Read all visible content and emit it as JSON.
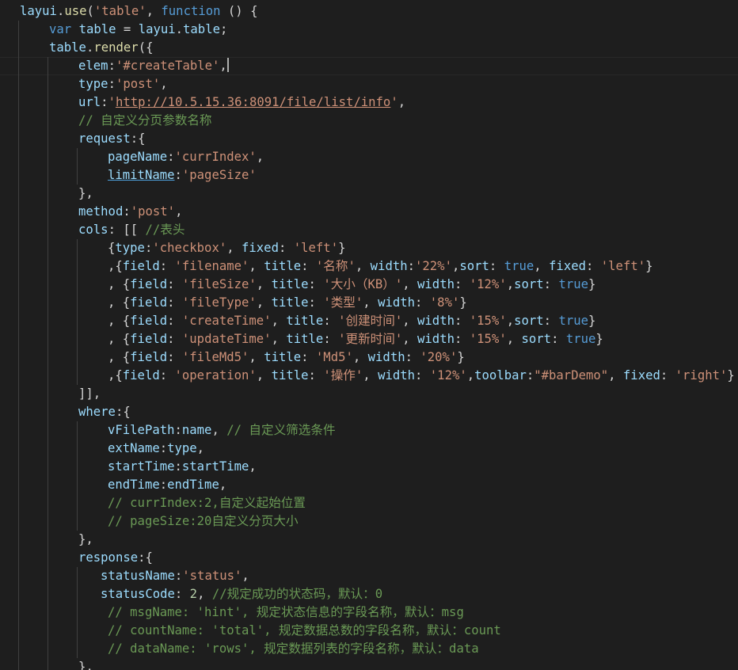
{
  "editor": {
    "background": "#1e1e1e",
    "token_colors": {
      "plain": "#d4d4d4",
      "var": "#9cdcfe",
      "str": "#ce9178",
      "kw": "#569cd6",
      "com": "#6a9955",
      "num": "#b5cea8",
      "fn": "#dcdcaa"
    },
    "cursor_line": 4,
    "lines": [
      {
        "indent": 0,
        "tokens": [
          {
            "t": "var",
            "v": "layui"
          },
          {
            "t": "plain",
            "v": "."
          },
          {
            "t": "fn",
            "v": "use"
          },
          {
            "t": "plain",
            "v": "("
          },
          {
            "t": "str",
            "v": "'table'"
          },
          {
            "t": "plain",
            "v": ", "
          },
          {
            "t": "kw",
            "v": "function"
          },
          {
            "t": "plain",
            "v": " () {"
          }
        ]
      },
      {
        "indent": 1,
        "tokens": [
          {
            "t": "kw",
            "v": "var"
          },
          {
            "t": "plain",
            "v": " "
          },
          {
            "t": "var",
            "v": "table"
          },
          {
            "t": "plain",
            "v": " = "
          },
          {
            "t": "var",
            "v": "layui"
          },
          {
            "t": "plain",
            "v": "."
          },
          {
            "t": "var",
            "v": "table"
          },
          {
            "t": "plain",
            "v": ";"
          }
        ]
      },
      {
        "indent": 1,
        "tokens": [
          {
            "t": "var",
            "v": "table"
          },
          {
            "t": "plain",
            "v": "."
          },
          {
            "t": "fn",
            "v": "render"
          },
          {
            "t": "plain",
            "v": "({"
          }
        ]
      },
      {
        "indent": 2,
        "tokens": [
          {
            "t": "var",
            "v": "elem"
          },
          {
            "t": "plain",
            "v": ":"
          },
          {
            "t": "str",
            "v": "'#createTable'"
          },
          {
            "t": "plain",
            "v": ","
          }
        ]
      },
      {
        "indent": 2,
        "tokens": [
          {
            "t": "var",
            "v": "type"
          },
          {
            "t": "plain",
            "v": ":"
          },
          {
            "t": "str",
            "v": "'post'"
          },
          {
            "t": "plain",
            "v": ","
          }
        ]
      },
      {
        "indent": 2,
        "tokens": [
          {
            "t": "var",
            "v": "url"
          },
          {
            "t": "plain",
            "v": ":"
          },
          {
            "t": "str",
            "v": "'"
          },
          {
            "t": "link",
            "v": "http://10.5.15.36:8091/file/list/info"
          },
          {
            "t": "str",
            "v": "'"
          },
          {
            "t": "plain",
            "v": ","
          }
        ]
      },
      {
        "indent": 2,
        "tokens": [
          {
            "t": "com",
            "v": "// 自定义分页参数名称"
          }
        ]
      },
      {
        "indent": 2,
        "tokens": [
          {
            "t": "var",
            "v": "request"
          },
          {
            "t": "plain",
            "v": ":{"
          }
        ]
      },
      {
        "indent": 3,
        "tokens": [
          {
            "t": "var",
            "v": "pageName"
          },
          {
            "t": "plain",
            "v": ":"
          },
          {
            "t": "str",
            "v": "'currIndex'"
          },
          {
            "t": "plain",
            "v": ","
          }
        ]
      },
      {
        "indent": 3,
        "tokens": [
          {
            "t": "warn",
            "v": "limitName"
          },
          {
            "t": "plain",
            "v": ":"
          },
          {
            "t": "str",
            "v": "'pageSize'"
          }
        ]
      },
      {
        "indent": 2,
        "tokens": [
          {
            "t": "plain",
            "v": "},"
          }
        ]
      },
      {
        "indent": 2,
        "tokens": [
          {
            "t": "var",
            "v": "method"
          },
          {
            "t": "plain",
            "v": ":"
          },
          {
            "t": "str",
            "v": "'post'"
          },
          {
            "t": "plain",
            "v": ","
          }
        ]
      },
      {
        "indent": 2,
        "tokens": [
          {
            "t": "var",
            "v": "cols"
          },
          {
            "t": "plain",
            "v": ": [[ "
          },
          {
            "t": "com",
            "v": "//表头"
          }
        ]
      },
      {
        "indent": 3,
        "tokens": [
          {
            "t": "plain",
            "v": "{"
          },
          {
            "t": "var",
            "v": "type"
          },
          {
            "t": "plain",
            "v": ":"
          },
          {
            "t": "str",
            "v": "'checkbox'"
          },
          {
            "t": "plain",
            "v": ", "
          },
          {
            "t": "var",
            "v": "fixed"
          },
          {
            "t": "plain",
            "v": ": "
          },
          {
            "t": "str",
            "v": "'left'"
          },
          {
            "t": "plain",
            "v": "}"
          }
        ]
      },
      {
        "indent": 3,
        "tokens": [
          {
            "t": "plain",
            "v": ",{"
          },
          {
            "t": "var",
            "v": "field"
          },
          {
            "t": "plain",
            "v": ": "
          },
          {
            "t": "str",
            "v": "'filename'"
          },
          {
            "t": "plain",
            "v": ", "
          },
          {
            "t": "var",
            "v": "title"
          },
          {
            "t": "plain",
            "v": ": "
          },
          {
            "t": "str",
            "v": "'名称'"
          },
          {
            "t": "plain",
            "v": ", "
          },
          {
            "t": "var",
            "v": "width"
          },
          {
            "t": "plain",
            "v": ":"
          },
          {
            "t": "str",
            "v": "'22%'"
          },
          {
            "t": "plain",
            "v": ","
          },
          {
            "t": "var",
            "v": "sort"
          },
          {
            "t": "plain",
            "v": ": "
          },
          {
            "t": "kw",
            "v": "true"
          },
          {
            "t": "plain",
            "v": ", "
          },
          {
            "t": "var",
            "v": "fixed"
          },
          {
            "t": "plain",
            "v": ": "
          },
          {
            "t": "str",
            "v": "'left'"
          },
          {
            "t": "plain",
            "v": "}"
          }
        ]
      },
      {
        "indent": 3,
        "tokens": [
          {
            "t": "plain",
            "v": ", {"
          },
          {
            "t": "var",
            "v": "field"
          },
          {
            "t": "plain",
            "v": ": "
          },
          {
            "t": "str",
            "v": "'fileSize'"
          },
          {
            "t": "plain",
            "v": ", "
          },
          {
            "t": "var",
            "v": "title"
          },
          {
            "t": "plain",
            "v": ": "
          },
          {
            "t": "str",
            "v": "'大小（KB）'"
          },
          {
            "t": "plain",
            "v": ", "
          },
          {
            "t": "var",
            "v": "width"
          },
          {
            "t": "plain",
            "v": ": "
          },
          {
            "t": "str",
            "v": "'12%'"
          },
          {
            "t": "plain",
            "v": ","
          },
          {
            "t": "var",
            "v": "sort"
          },
          {
            "t": "plain",
            "v": ": "
          },
          {
            "t": "kw",
            "v": "true"
          },
          {
            "t": "plain",
            "v": "}"
          }
        ]
      },
      {
        "indent": 3,
        "tokens": [
          {
            "t": "plain",
            "v": ", {"
          },
          {
            "t": "var",
            "v": "field"
          },
          {
            "t": "plain",
            "v": ": "
          },
          {
            "t": "str",
            "v": "'fileType'"
          },
          {
            "t": "plain",
            "v": ", "
          },
          {
            "t": "var",
            "v": "title"
          },
          {
            "t": "plain",
            "v": ": "
          },
          {
            "t": "str",
            "v": "'类型'"
          },
          {
            "t": "plain",
            "v": ", "
          },
          {
            "t": "var",
            "v": "width"
          },
          {
            "t": "plain",
            "v": ": "
          },
          {
            "t": "str",
            "v": "'8%'"
          },
          {
            "t": "plain",
            "v": "}"
          }
        ]
      },
      {
        "indent": 3,
        "tokens": [
          {
            "t": "plain",
            "v": ", {"
          },
          {
            "t": "var",
            "v": "field"
          },
          {
            "t": "plain",
            "v": ": "
          },
          {
            "t": "str",
            "v": "'createTime'"
          },
          {
            "t": "plain",
            "v": ", "
          },
          {
            "t": "var",
            "v": "title"
          },
          {
            "t": "plain",
            "v": ": "
          },
          {
            "t": "str",
            "v": "'创建时间'"
          },
          {
            "t": "plain",
            "v": ", "
          },
          {
            "t": "var",
            "v": "width"
          },
          {
            "t": "plain",
            "v": ": "
          },
          {
            "t": "str",
            "v": "'15%'"
          },
          {
            "t": "plain",
            "v": ","
          },
          {
            "t": "var",
            "v": "sort"
          },
          {
            "t": "plain",
            "v": ": "
          },
          {
            "t": "kw",
            "v": "true"
          },
          {
            "t": "plain",
            "v": "}"
          }
        ]
      },
      {
        "indent": 3,
        "tokens": [
          {
            "t": "plain",
            "v": ", {"
          },
          {
            "t": "var",
            "v": "field"
          },
          {
            "t": "plain",
            "v": ": "
          },
          {
            "t": "str",
            "v": "'updateTime'"
          },
          {
            "t": "plain",
            "v": ", "
          },
          {
            "t": "var",
            "v": "title"
          },
          {
            "t": "plain",
            "v": ": "
          },
          {
            "t": "str",
            "v": "'更新时间'"
          },
          {
            "t": "plain",
            "v": ", "
          },
          {
            "t": "var",
            "v": "width"
          },
          {
            "t": "plain",
            "v": ": "
          },
          {
            "t": "str",
            "v": "'15%'"
          },
          {
            "t": "plain",
            "v": ", "
          },
          {
            "t": "var",
            "v": "sort"
          },
          {
            "t": "plain",
            "v": ": "
          },
          {
            "t": "kw",
            "v": "true"
          },
          {
            "t": "plain",
            "v": "}"
          }
        ]
      },
      {
        "indent": 3,
        "tokens": [
          {
            "t": "plain",
            "v": ", {"
          },
          {
            "t": "var",
            "v": "field"
          },
          {
            "t": "plain",
            "v": ": "
          },
          {
            "t": "str",
            "v": "'fileMd5'"
          },
          {
            "t": "plain",
            "v": ", "
          },
          {
            "t": "var",
            "v": "title"
          },
          {
            "t": "plain",
            "v": ": "
          },
          {
            "t": "str",
            "v": "'Md5'"
          },
          {
            "t": "plain",
            "v": ", "
          },
          {
            "t": "var",
            "v": "width"
          },
          {
            "t": "plain",
            "v": ": "
          },
          {
            "t": "str",
            "v": "'20%'"
          },
          {
            "t": "plain",
            "v": "}"
          }
        ]
      },
      {
        "indent": 3,
        "tokens": [
          {
            "t": "plain",
            "v": ",{"
          },
          {
            "t": "var",
            "v": "field"
          },
          {
            "t": "plain",
            "v": ": "
          },
          {
            "t": "str",
            "v": "'operation'"
          },
          {
            "t": "plain",
            "v": ", "
          },
          {
            "t": "var",
            "v": "title"
          },
          {
            "t": "plain",
            "v": ": "
          },
          {
            "t": "str",
            "v": "'操作'"
          },
          {
            "t": "plain",
            "v": ", "
          },
          {
            "t": "var",
            "v": "width"
          },
          {
            "t": "plain",
            "v": ": "
          },
          {
            "t": "str",
            "v": "'12%'"
          },
          {
            "t": "plain",
            "v": ","
          },
          {
            "t": "var",
            "v": "toolbar"
          },
          {
            "t": "plain",
            "v": ":"
          },
          {
            "t": "str",
            "v": "\"#barDemo\""
          },
          {
            "t": "plain",
            "v": ", "
          },
          {
            "t": "var",
            "v": "fixed"
          },
          {
            "t": "plain",
            "v": ": "
          },
          {
            "t": "str",
            "v": "'right'"
          },
          {
            "t": "plain",
            "v": "}"
          }
        ]
      },
      {
        "indent": 2,
        "tokens": [
          {
            "t": "plain",
            "v": "]],"
          }
        ]
      },
      {
        "indent": 2,
        "tokens": [
          {
            "t": "var",
            "v": "where"
          },
          {
            "t": "plain",
            "v": ":{"
          }
        ]
      },
      {
        "indent": 3,
        "tokens": [
          {
            "t": "var",
            "v": "vFilePath"
          },
          {
            "t": "plain",
            "v": ":"
          },
          {
            "t": "var",
            "v": "name"
          },
          {
            "t": "plain",
            "v": ", "
          },
          {
            "t": "com",
            "v": "// 自定义筛选条件"
          }
        ]
      },
      {
        "indent": 3,
        "tokens": [
          {
            "t": "var",
            "v": "extName"
          },
          {
            "t": "plain",
            "v": ":"
          },
          {
            "t": "var",
            "v": "type"
          },
          {
            "t": "plain",
            "v": ","
          }
        ]
      },
      {
        "indent": 3,
        "tokens": [
          {
            "t": "var",
            "v": "startTime"
          },
          {
            "t": "plain",
            "v": ":"
          },
          {
            "t": "var",
            "v": "startTime"
          },
          {
            "t": "plain",
            "v": ","
          }
        ]
      },
      {
        "indent": 3,
        "tokens": [
          {
            "t": "var",
            "v": "endTime"
          },
          {
            "t": "plain",
            "v": ":"
          },
          {
            "t": "var",
            "v": "endTime"
          },
          {
            "t": "plain",
            "v": ","
          }
        ]
      },
      {
        "indent": 3,
        "tokens": [
          {
            "t": "com",
            "v": "// currIndex:2,自定义起始位置"
          }
        ]
      },
      {
        "indent": 3,
        "tokens": [
          {
            "t": "com",
            "v": "// pageSize:20自定义分页大小"
          }
        ]
      },
      {
        "indent": 2,
        "tokens": [
          {
            "t": "plain",
            "v": "},"
          }
        ]
      },
      {
        "indent": 2,
        "tokens": [
          {
            "t": "var",
            "v": "response"
          },
          {
            "t": "plain",
            "v": ":{"
          }
        ]
      },
      {
        "indent": 3,
        "shift": -1,
        "tokens": [
          {
            "t": "var",
            "v": "statusName"
          },
          {
            "t": "plain",
            "v": ":"
          },
          {
            "t": "str",
            "v": "'status'"
          },
          {
            "t": "plain",
            "v": ","
          }
        ]
      },
      {
        "indent": 3,
        "shift": -1,
        "tokens": [
          {
            "t": "var",
            "v": "statusCode"
          },
          {
            "t": "plain",
            "v": ": "
          },
          {
            "t": "num",
            "v": "2"
          },
          {
            "t": "plain",
            "v": ", "
          },
          {
            "t": "com",
            "v": "//规定成功的状态码，默认：0"
          }
        ]
      },
      {
        "indent": 3,
        "tokens": [
          {
            "t": "com",
            "v": "// msgName: 'hint', 规定状态信息的字段名称，默认：msg"
          }
        ]
      },
      {
        "indent": 3,
        "tokens": [
          {
            "t": "com",
            "v": "// countName: 'total', 规定数据总数的字段名称，默认：count"
          }
        ]
      },
      {
        "indent": 3,
        "tokens": [
          {
            "t": "com",
            "v": "// dataName: 'rows', 规定数据列表的字段名称，默认：data"
          }
        ]
      },
      {
        "indent": 2,
        "tokens": [
          {
            "t": "plain",
            "v": "},"
          }
        ]
      }
    ]
  }
}
